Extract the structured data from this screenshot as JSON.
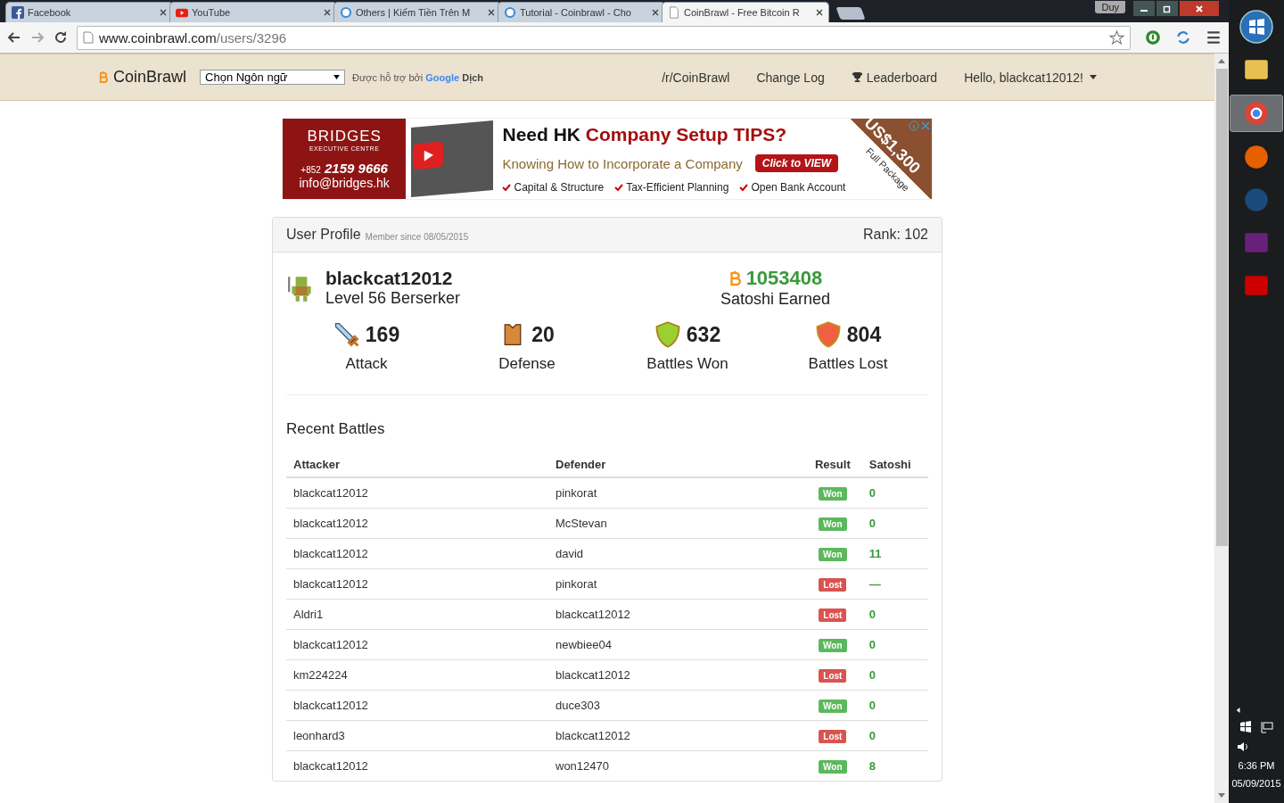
{
  "browser": {
    "tabs": [
      {
        "title": "Facebook",
        "kind": "facebook",
        "selected": false
      },
      {
        "title": "YouTube",
        "kind": "youtube",
        "selected": false
      },
      {
        "title": "Others | Kiếm Tiền Trên M",
        "kind": "site",
        "selected": false
      },
      {
        "title": "Tutorial - Coinbrawl - Cho",
        "kind": "site",
        "selected": false
      },
      {
        "title": "CoinBrawl - Free Bitcoin R",
        "kind": "page",
        "selected": true
      }
    ],
    "user_badge": "Duy",
    "url_host": "www.coinbrawl.com",
    "url_path": "/users/3296"
  },
  "navbar": {
    "brand": "CoinBrawl",
    "language_select": "Chọn Ngôn ngữ",
    "translate_prefix": "Được hỗ trợ bởi",
    "translate_google": "Google",
    "translate_suffix": "Dịch",
    "links": [
      {
        "label": "/r/CoinBrawl",
        "kind": "plain"
      },
      {
        "label": "Change Log",
        "kind": "plain"
      },
      {
        "label": "Leaderboard",
        "kind": "trophy"
      },
      {
        "label": "Hello, blackcat12012!",
        "kind": "menu"
      }
    ]
  },
  "ad": {
    "brand": "BRIDGES",
    "brand_sub": "EXECUTIVE CENTRE",
    "phone_prefix": "+852",
    "phone": "2159 9666",
    "email": "info@bridges.hk",
    "headline_plain": "Need HK",
    "headline_accent": "Company Setup TIPS?",
    "subline": "Knowing How to Incorporate a Company",
    "cta": "Click to VIEW",
    "points": [
      "Capital & Structure",
      "Tax-Efficient Planning",
      "Open Bank Account"
    ],
    "price": "US$1,300",
    "price_sub": "Full Package"
  },
  "profile": {
    "title": "User Profile",
    "member_since": "Member since 08/05/2015",
    "rank": "Rank: 102",
    "username": "blackcat12012",
    "level": "Level 56 Berserker",
    "satoshi": "1053408",
    "satoshi_label": "Satoshi Earned",
    "stats": [
      {
        "kind": "sword",
        "value": "169",
        "label": "Attack"
      },
      {
        "kind": "armor",
        "value": "20",
        "label": "Defense"
      },
      {
        "kind": "shield-won",
        "value": "632",
        "label": "Battles Won"
      },
      {
        "kind": "shield-lost",
        "value": "804",
        "label": "Battles Lost"
      }
    ]
  },
  "recent_battles": {
    "title": "Recent Battles",
    "columns": [
      "Attacker",
      "Defender",
      "Result",
      "Satoshi"
    ],
    "rows": [
      {
        "attacker": "blackcat12012",
        "defender": "pinkorat",
        "result": "Won",
        "satoshi": "0"
      },
      {
        "attacker": "blackcat12012",
        "defender": "McStevan",
        "result": "Won",
        "satoshi": "0"
      },
      {
        "attacker": "blackcat12012",
        "defender": "david",
        "result": "Won",
        "satoshi": "11"
      },
      {
        "attacker": "blackcat12012",
        "defender": "pinkorat",
        "result": "Lost",
        "satoshi": "—"
      },
      {
        "attacker": "Aldri1",
        "defender": "blackcat12012",
        "result": "Lost",
        "satoshi": "0"
      },
      {
        "attacker": "blackcat12012",
        "defender": "newbiee04",
        "result": "Won",
        "satoshi": "0"
      },
      {
        "attacker": "km224224",
        "defender": "blackcat12012",
        "result": "Lost",
        "satoshi": "0"
      },
      {
        "attacker": "blackcat12012",
        "defender": "duce303",
        "result": "Won",
        "satoshi": "0"
      },
      {
        "attacker": "leonhard3",
        "defender": "blackcat12012",
        "result": "Lost",
        "satoshi": "0"
      },
      {
        "attacker": "blackcat12012",
        "defender": "won12470",
        "result": "Won",
        "satoshi": "8"
      }
    ]
  },
  "taskbar": {
    "apps": [
      {
        "kind": "explorer",
        "selected": false
      },
      {
        "kind": "chrome",
        "selected": true
      },
      {
        "kind": "firefox",
        "selected": false
      },
      {
        "kind": "steam",
        "selected": false
      },
      {
        "kind": "vs",
        "selected": false
      },
      {
        "kind": "flash",
        "selected": false
      }
    ],
    "time": "6:36 PM",
    "date": "05/09/2015"
  }
}
